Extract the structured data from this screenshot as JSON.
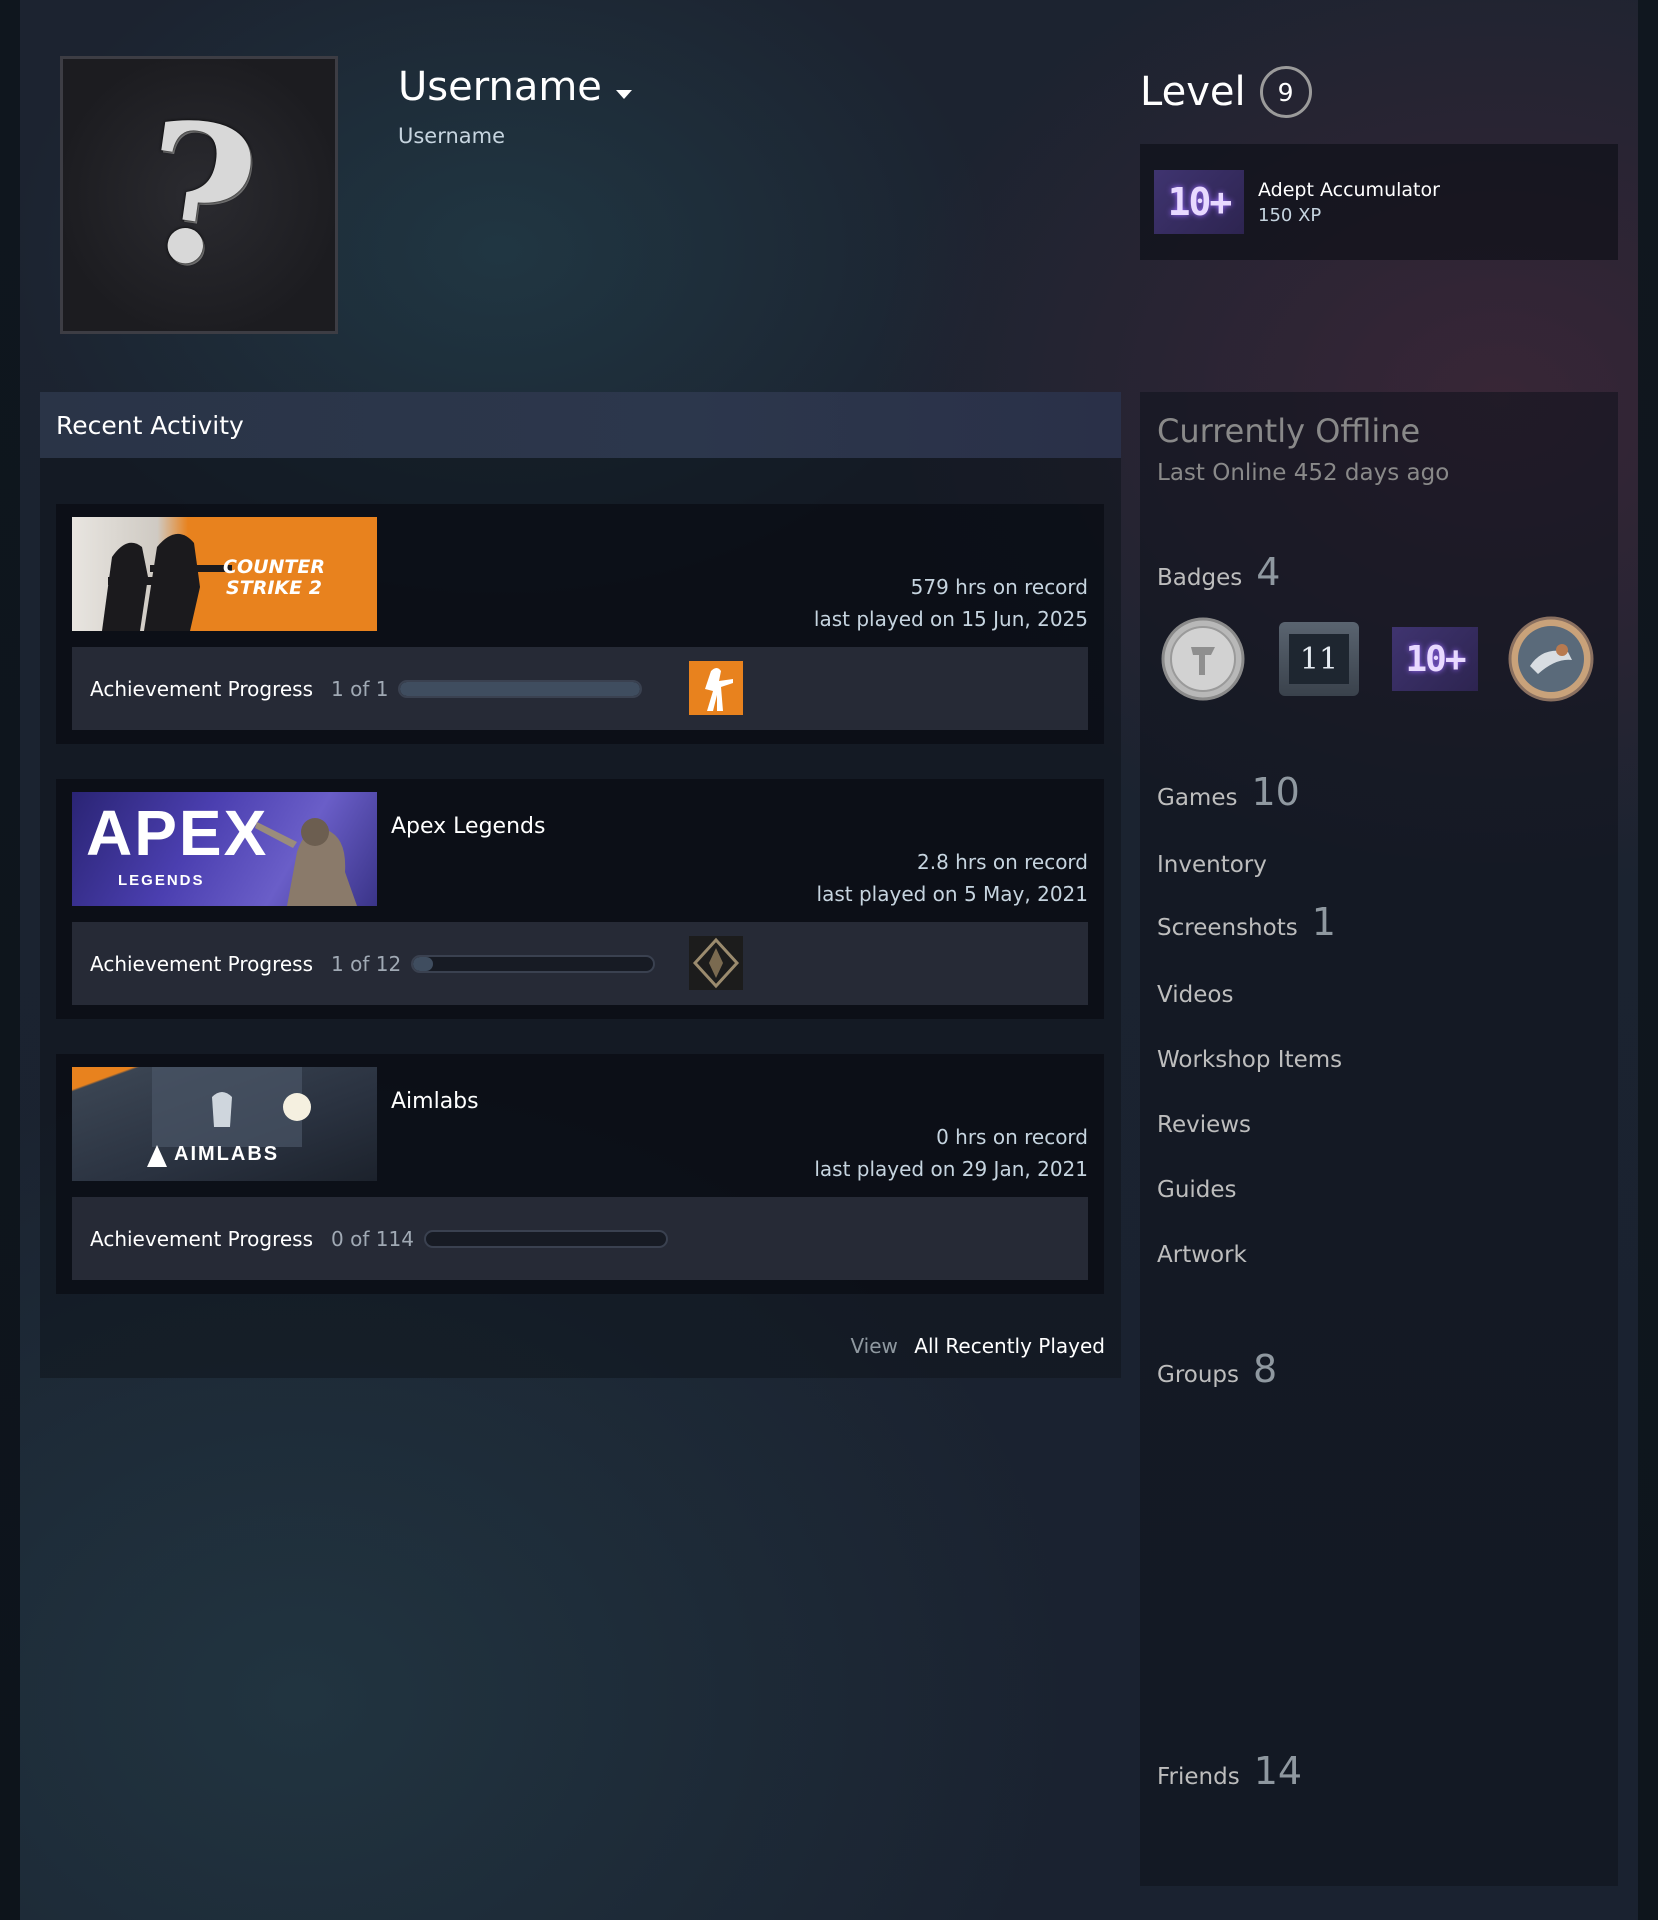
{
  "profile": {
    "username": "Username",
    "realname": "Username",
    "avatar_glyph": "?"
  },
  "level": {
    "label": "Level",
    "value": "9"
  },
  "favorite_badge": {
    "icon_text": "10+",
    "name": "Adept Accumulator",
    "xp": "150 XP"
  },
  "recent": {
    "title": "Recent Activity",
    "games": [
      {
        "name": "",
        "capsule_text": "COUNTER STRIKE 2",
        "hours": "579 hrs on record",
        "last_played": "last played on 15 Jun, 2025",
        "ach_label": "Achievement Progress",
        "ach_count": "1 of 1",
        "ach_fraction": 1.0
      },
      {
        "name": "Apex Legends",
        "capsule_text": "APEX",
        "capsule_sub": "LEGENDS",
        "hours": "2.8 hrs on record",
        "last_played": "last played on 5 May, 2021",
        "ach_label": "Achievement Progress",
        "ach_count": "1 of 12",
        "ach_fraction": 0.083
      },
      {
        "name": "Aimlabs",
        "capsule_text": "AIMLABS",
        "hours": "0 hrs on record",
        "last_played": "last played on 29 Jan, 2021",
        "ach_label": "Achievement Progress",
        "ach_count": "0 of 114",
        "ach_fraction": 0
      }
    ],
    "view_label": "View",
    "view_link": "All Recently Played"
  },
  "sidebar": {
    "status": "Currently Offline",
    "last_online": "Last Online 452 days ago",
    "badges": {
      "label": "Badges",
      "count": "4",
      "icon_names": [
        "coin-badge-icon",
        "years-badge-icon",
        "ten-plus-badge-icon",
        "community-badge-icon"
      ],
      "years_text": "11",
      "ten_text": "10+"
    },
    "games": {
      "label": "Games",
      "count": "10"
    },
    "inventory": "Inventory",
    "screenshots": {
      "label": "Screenshots",
      "count": "1"
    },
    "videos": "Videos",
    "workshop": "Workshop Items",
    "reviews": "Reviews",
    "guides": "Guides",
    "artwork": "Artwork",
    "groups": {
      "label": "Groups",
      "count": "8"
    },
    "friends": {
      "label": "Friends",
      "count": "14"
    }
  },
  "colors": {
    "cs_orange": "#e8821e",
    "apex_purple": "#4b3fb0",
    "badge_purple": "#3f3470"
  }
}
